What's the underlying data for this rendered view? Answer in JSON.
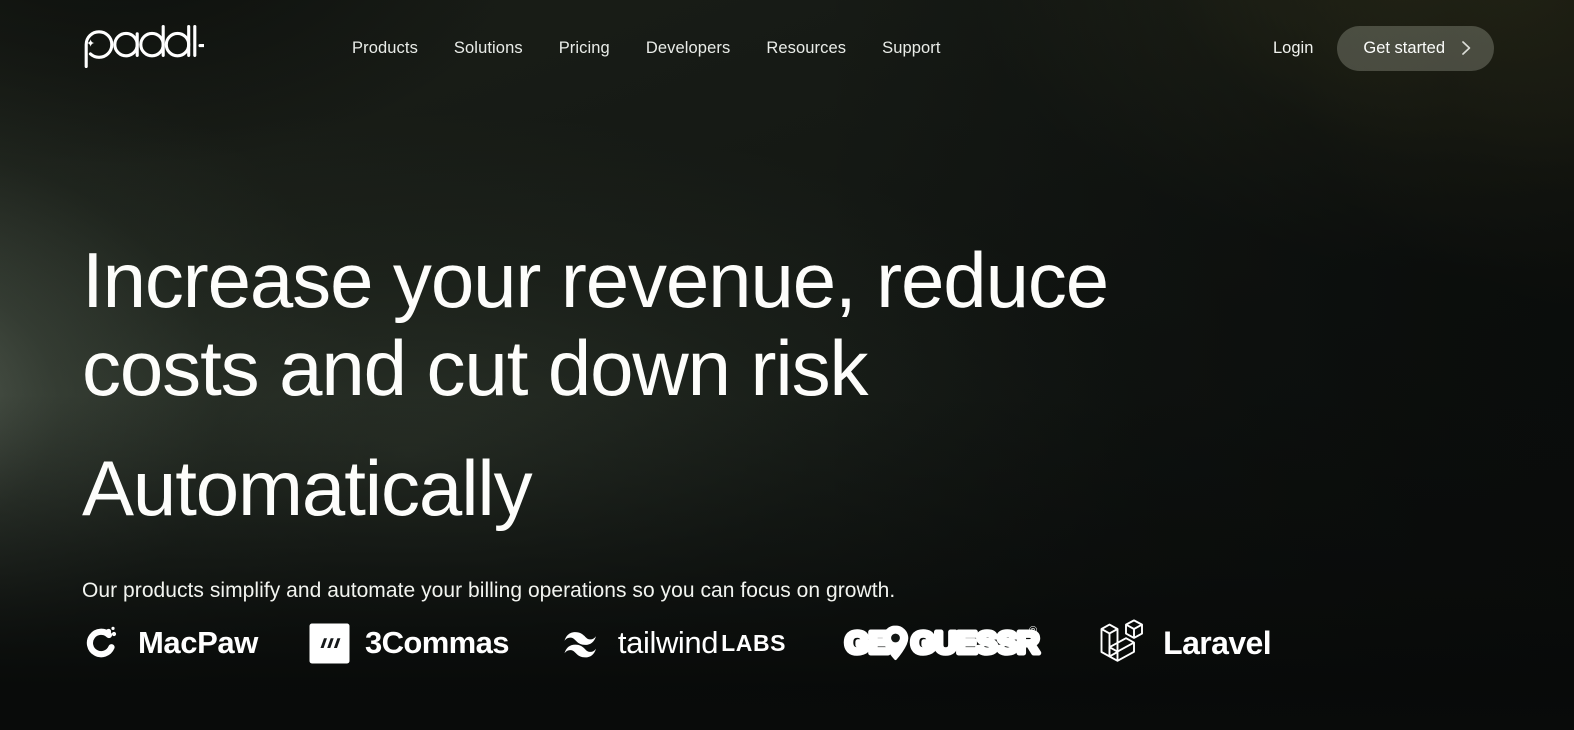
{
  "brand": {
    "name": "paddle",
    "logo_icon": "paddle-logo"
  },
  "nav": {
    "items": [
      {
        "label": "Products"
      },
      {
        "label": "Solutions"
      },
      {
        "label": "Pricing"
      },
      {
        "label": "Developers"
      },
      {
        "label": "Resources"
      },
      {
        "label": "Support"
      }
    ]
  },
  "header_actions": {
    "login_label": "Login",
    "cta_label": "Get started",
    "cta_icon": "chevron-right-icon"
  },
  "hero": {
    "headline": "Increase your revenue, reduce costs and cut down risk",
    "headline_secondary": "Automatically",
    "subheadline": "Our products simplify and automate your billing operations so you can focus on growth."
  },
  "partner_logos": [
    {
      "name": "MacPaw",
      "icon": "macpaw-icon",
      "wordmark": "MacPaw"
    },
    {
      "name": "3Commas",
      "icon": "3commas-icon",
      "wordmark": "3Commas"
    },
    {
      "name": "tailwindLABS",
      "icon": "tailwind-icon",
      "wordmark": "tailwind",
      "wordmark_bold": "LABS"
    },
    {
      "name": "GeoGuessr",
      "icon": "geoguessr-icon",
      "wordmark": "GEOGUESSR",
      "trademark": "®"
    },
    {
      "name": "Laravel",
      "icon": "laravel-icon",
      "wordmark": "Laravel"
    }
  ],
  "colors": {
    "background_dark": "#10130f",
    "accent_olive": "#8c883e",
    "accent_sage": "#b9c6b4",
    "text_primary": "#fdfdfb",
    "cta_background": "rgba(208,214,196,0.26)"
  }
}
